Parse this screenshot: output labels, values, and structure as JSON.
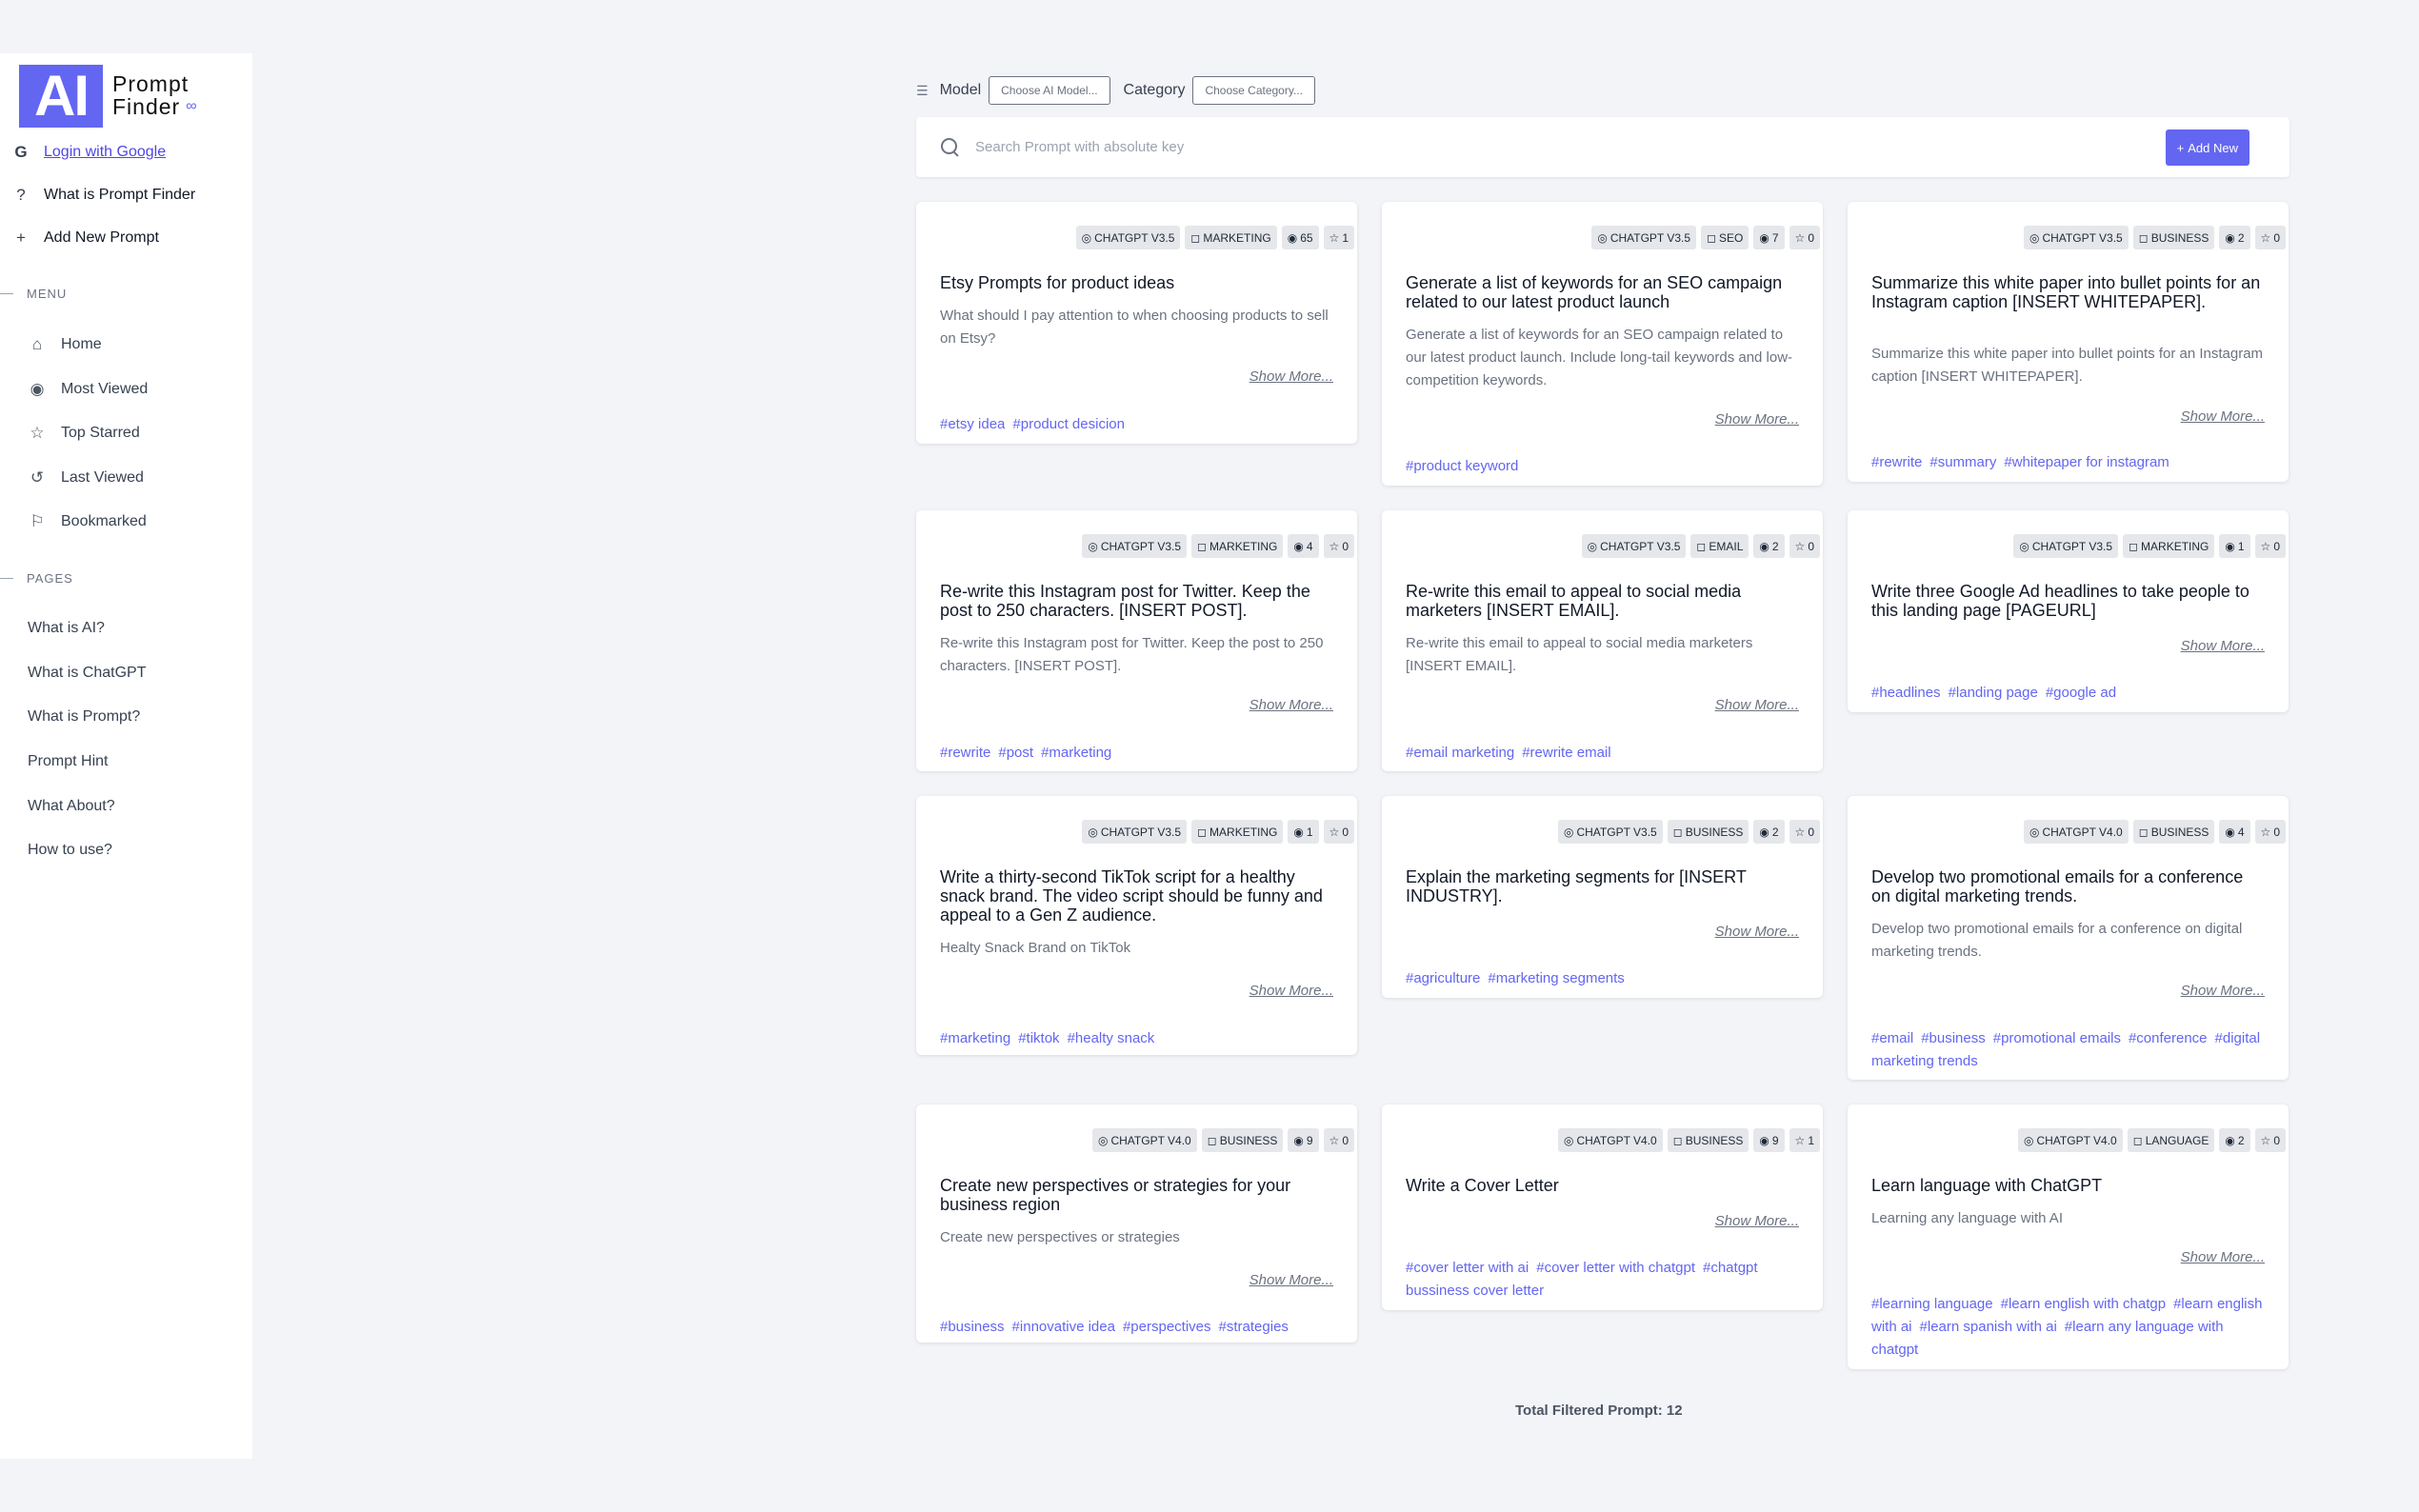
{
  "logo": {
    "mark": "AI",
    "line1": "Prompt",
    "line2": "Finder",
    "infinity": "∞"
  },
  "sidebar": {
    "login": "Login with Google",
    "what_is": "What is Prompt Finder",
    "add_new": "Add New Prompt",
    "menu_head": "MENU",
    "menu": [
      "Home",
      "Most Viewed",
      "Top Starred",
      "Last Viewed",
      "Bookmarked"
    ],
    "pages_head": "PAGES",
    "pages": [
      "What is AI?",
      "What is ChatGPT",
      "What is Prompt?",
      "Prompt Hint",
      "What About?",
      "How to use?"
    ]
  },
  "filters": {
    "model_label": "Model",
    "model_placeholder": "Choose AI Model...",
    "category_label": "Category",
    "category_placeholder": "Choose Category..."
  },
  "search": {
    "placeholder": "Search Prompt with absolute key",
    "add_label": "Add New"
  },
  "show_more": "Show More...",
  "cards": [
    {
      "model": "CHATGPT V3.5",
      "category": "MARKETING",
      "views": "65",
      "stars": "1",
      "title": "Etsy Prompts for product ideas",
      "desc": "What should I pay attention to when choosing products to sell on Etsy?",
      "tags": [
        "#etsy idea",
        "#product desicion"
      ]
    },
    {
      "model": "CHATGPT V3.5",
      "category": "SEO",
      "views": "7",
      "stars": "0",
      "title": "Generate a list of keywords for an SEO campaign related to our latest product launch",
      "desc": "Generate a list of keywords for an SEO campaign related to our latest product launch. Include long-tail keywords and low-competition keywords.",
      "tags": [
        "#product keyword"
      ]
    },
    {
      "model": "CHATGPT V3.5",
      "category": "BUSINESS",
      "views": "2",
      "stars": "0",
      "title": "Summarize this white paper into bullet points for an Instagram caption [INSERT WHITEPAPER].",
      "desc": "Summarize this white paper into bullet points for an Instagram caption [INSERT WHITEPAPER].",
      "tags": [
        "#rewrite",
        "#summary",
        "#whitepaper for instagram"
      ]
    },
    {
      "model": "CHATGPT V3.5",
      "category": "MARKETING",
      "views": "4",
      "stars": "0",
      "title": "Re-write this Instagram post for Twitter. Keep the post to 250 characters. [INSERT POST].",
      "desc": "Re-write this Instagram post for Twitter. Keep the post to 250 characters. [INSERT POST].",
      "tags": [
        "#rewrite",
        "#post",
        "#marketing"
      ]
    },
    {
      "model": "CHATGPT V3.5",
      "category": "EMAIL",
      "views": "2",
      "stars": "0",
      "title": "Re-write this email to appeal to social media marketers [INSERT EMAIL].",
      "desc": "Re-write this email to appeal to social media marketers [INSERT EMAIL].",
      "tags": [
        "#email marketing",
        "#rewrite email"
      ]
    },
    {
      "model": "CHATGPT V3.5",
      "category": "MARKETING",
      "views": "1",
      "stars": "0",
      "title": "Write three Google Ad headlines to take people to this landing page [PAGEURL]",
      "desc": "",
      "tags": [
        "#headlines",
        "#landing page",
        "#google ad"
      ]
    },
    {
      "model": "CHATGPT V3.5",
      "category": "MARKETING",
      "views": "1",
      "stars": "0",
      "title": "Write a thirty-second TikTok script for a healthy snack brand. The video script should be funny and appeal to a Gen Z audience.",
      "desc": "Healty Snack Brand on TikTok",
      "tags": [
        "#marketing",
        "#tiktok",
        "#healty snack"
      ]
    },
    {
      "model": "CHATGPT V3.5",
      "category": "BUSINESS",
      "views": "2",
      "stars": "0",
      "title": "Explain the marketing segments for [INSERT INDUSTRY].",
      "desc": "",
      "tags": [
        "#agriculture",
        "#marketing segments"
      ]
    },
    {
      "model": "CHATGPT V4.0",
      "category": "BUSINESS",
      "views": "4",
      "stars": "0",
      "title": "Develop two promotional emails for a conference on digital marketing trends.",
      "desc": "Develop two promotional emails for a conference on digital marketing trends.",
      "tags": [
        "#email",
        "#business",
        "#promotional emails",
        "#conference",
        "#digital marketing trends"
      ]
    },
    {
      "model": "CHATGPT V4.0",
      "category": "BUSINESS",
      "views": "9",
      "stars": "0",
      "title": "Create new perspectives or strategies for your business region",
      "desc": "Create new perspectives or strategies",
      "tags": [
        "#business",
        "#innovative idea",
        "#perspectives",
        "#strategies"
      ]
    },
    {
      "model": "CHATGPT V4.0",
      "category": "BUSINESS",
      "views": "9",
      "stars": "1",
      "title": "Write a Cover Letter",
      "desc": "",
      "tags": [
        "#cover letter with ai",
        "#cover letter with chatgpt",
        "#chatgpt bussiness cover letter"
      ]
    },
    {
      "model": "CHATGPT V4.0",
      "category": "LANGUAGE",
      "views": "2",
      "stars": "0",
      "title": "Learn language with ChatGPT",
      "desc": "Learning any language with AI",
      "tags": [
        "#learning language",
        "#learn english with chatgp",
        "#learn english with ai",
        "#learn spanish with ai",
        "#learn any language with chatgpt"
      ]
    }
  ],
  "total": "Total Filtered Prompt: 12"
}
